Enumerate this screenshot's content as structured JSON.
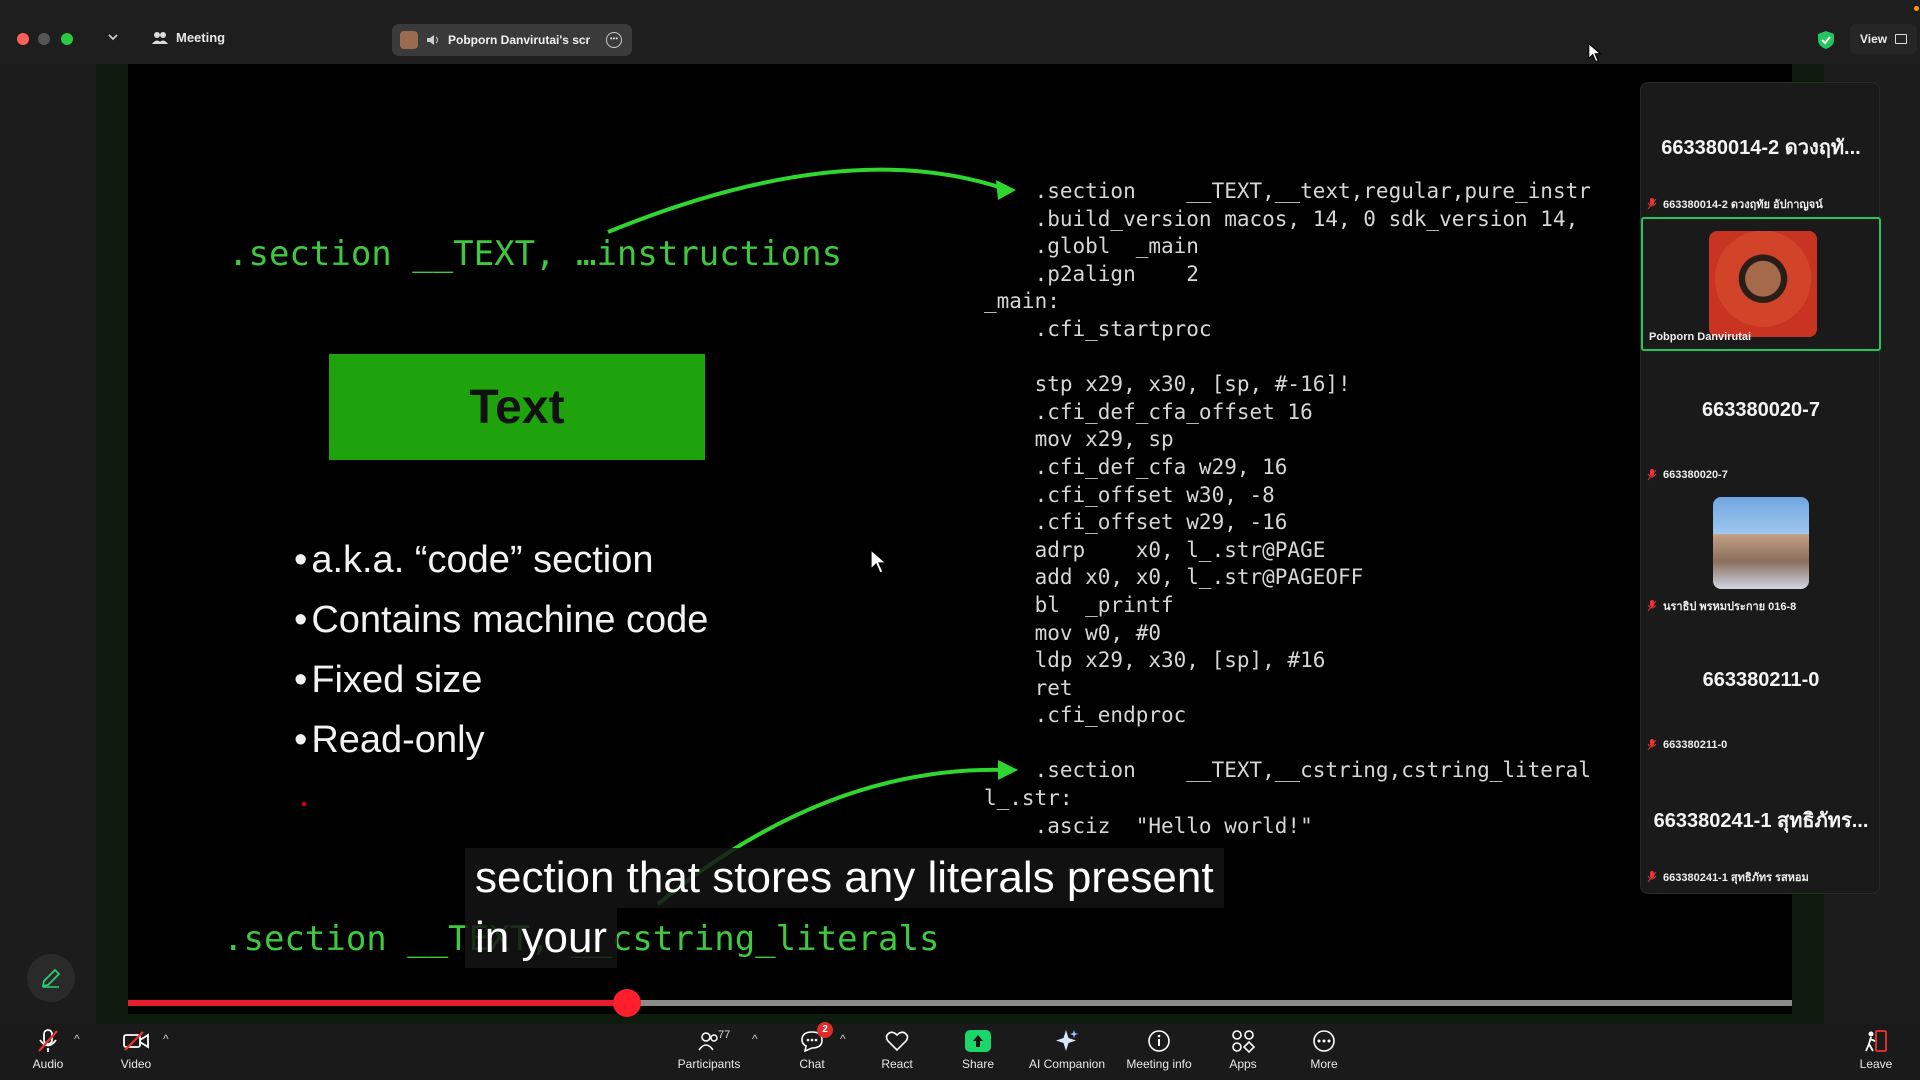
{
  "topbar": {
    "meeting_label": "Meeting",
    "share_pill_text": "Pobporn Danvirutai's scr",
    "view_label": "View"
  },
  "slide": {
    "left_title": ".section __TEXT, …instructions",
    "text_box": "Text",
    "bullets": [
      "a.k.a. “code” section",
      "Contains machine code",
      "Fixed size",
      "Read-only"
    ],
    "bottom_title": ".section __TEXT, __cstring_literals",
    "code_lines": [
      "    .section    __TEXT,__text,regular,pure_instr",
      "    .build_version macos, 14, 0 sdk_version 14,",
      "    .globl  _main",
      "    .p2align    2",
      "_main:",
      "    .cfi_startproc",
      "",
      "    stp x29, x30, [sp, #-16]!",
      "    .cfi_def_cfa_offset 16",
      "    mov x29, sp",
      "    .cfi_def_cfa w29, 16",
      "    .cfi_offset w30, -8",
      "    .cfi_offset w29, -16",
      "    adrp    x0, l_.str@PAGE",
      "    add x0, x0, l_.str@PAGEOFF",
      "    bl  _printf",
      "    mov w0, #0",
      "    ldp x29, x30, [sp], #16",
      "    ret",
      "    .cfi_endproc",
      "",
      "    .section    __TEXT,__cstring,cstring_literal",
      "l_.str:",
      "    .asciz  \"Hello world!\""
    ],
    "subtitle_lines": [
      "section that stores any literals present",
      "in your"
    ],
    "progress_fraction": 0.3
  },
  "participants": [
    {
      "big_name": "663380014-2  ดวงฤทั...",
      "label": "663380014-2  ดวงฤทัย อัปกาญจน์",
      "has_video": false,
      "active": false
    },
    {
      "big_name": "",
      "label": "Pobporn Danvirutai",
      "has_video": true,
      "active": true
    },
    {
      "big_name": "663380020-7",
      "label": "663380020-7",
      "has_video": false,
      "active": false
    },
    {
      "big_name": "",
      "label": "นราธิป พรหมประกาย 016-8",
      "has_video": true,
      "active": false
    },
    {
      "big_name": "663380211-0",
      "label": "663380211-0",
      "has_video": false,
      "active": false
    },
    {
      "big_name": "663380241-1 สุทธิภัทร...",
      "label": "663380241-1 สุทธิภัทร รสหอม",
      "has_video": false,
      "active": false
    }
  ],
  "toolbar": {
    "audio": "Audio",
    "video": "Video",
    "participants": "Participants",
    "participants_count": "77",
    "chat": "Chat",
    "chat_badge": "2",
    "react": "React",
    "share": "Share",
    "ai_companion": "AI Companion",
    "meeting_info": "Meeting info",
    "apps": "Apps",
    "more": "More",
    "leave": "Leave"
  },
  "colors": {
    "slide_green": "#3ec93e",
    "text_box_green": "#1fa30d",
    "progress_red": "#e81c2c",
    "active_border": "#22c55e",
    "share_green": "#1bd76b"
  }
}
